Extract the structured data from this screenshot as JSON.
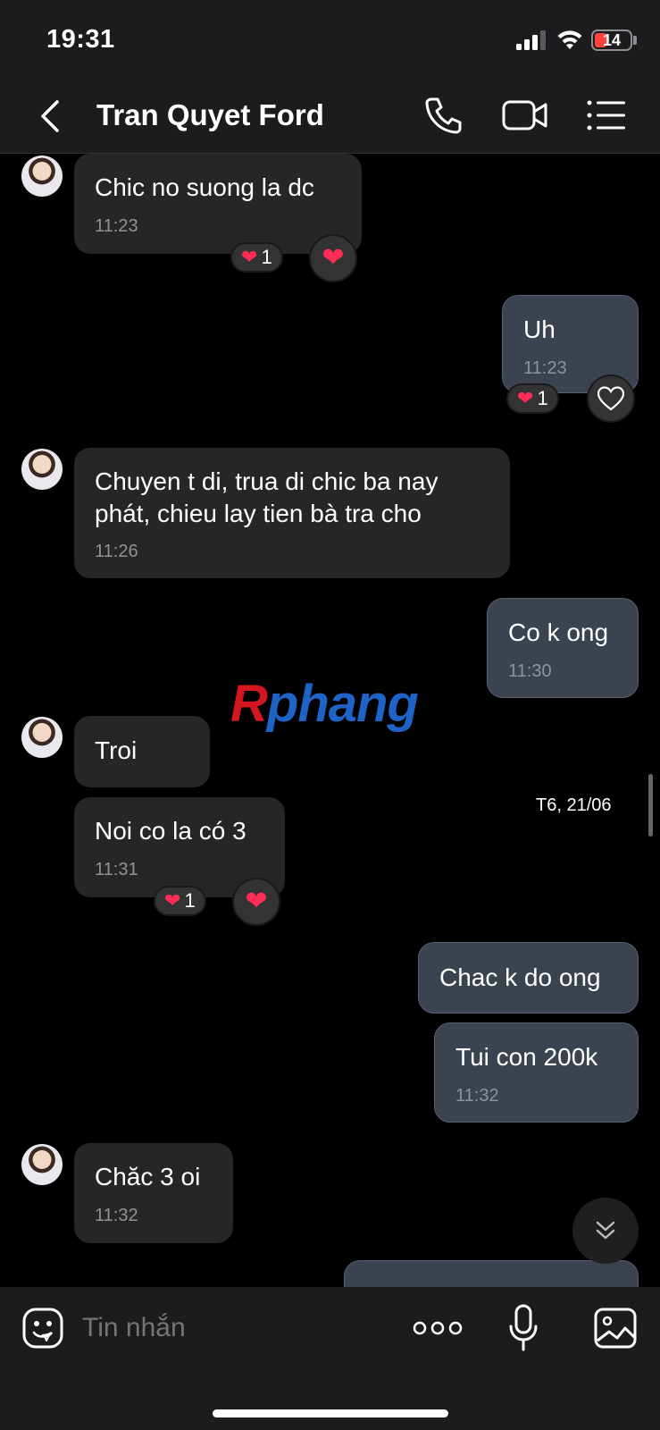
{
  "status_bar": {
    "time": "19:31",
    "battery": "14"
  },
  "header": {
    "title": "Tran Quyet Ford"
  },
  "messages": [
    {
      "text": "Chic no suong la dc",
      "time": "11:23",
      "reaction_count": "1"
    },
    {
      "text": "Uh",
      "time": "11:23",
      "reaction_count": "1"
    },
    {
      "text_line1": "Chuyen t di, trua di chic ba nay",
      "text_line2": "phát, chieu lay tien bà tra cho",
      "time": "11:26"
    },
    {
      "text": "Co k ong",
      "time": "11:30"
    },
    {
      "text": "Troi"
    },
    {
      "text": "Noi co la có 3",
      "time": "11:31",
      "reaction_count": "1"
    },
    {
      "text": "Chac k do ong"
    },
    {
      "text": "Tui con 200k",
      "time": "11:32"
    },
    {
      "text": "Chăc 3 oi",
      "time": "11:32"
    }
  ],
  "date_label": "T6, 21/06",
  "watermark": {
    "first": "R",
    "rest": "phang"
  },
  "composer": {
    "placeholder": "Tin nhắn"
  },
  "colors": {
    "incoming_bubble": "#262626",
    "outgoing_bubble": "#3b4350",
    "reaction_heart": "#ff2d55",
    "background": "#000000"
  }
}
